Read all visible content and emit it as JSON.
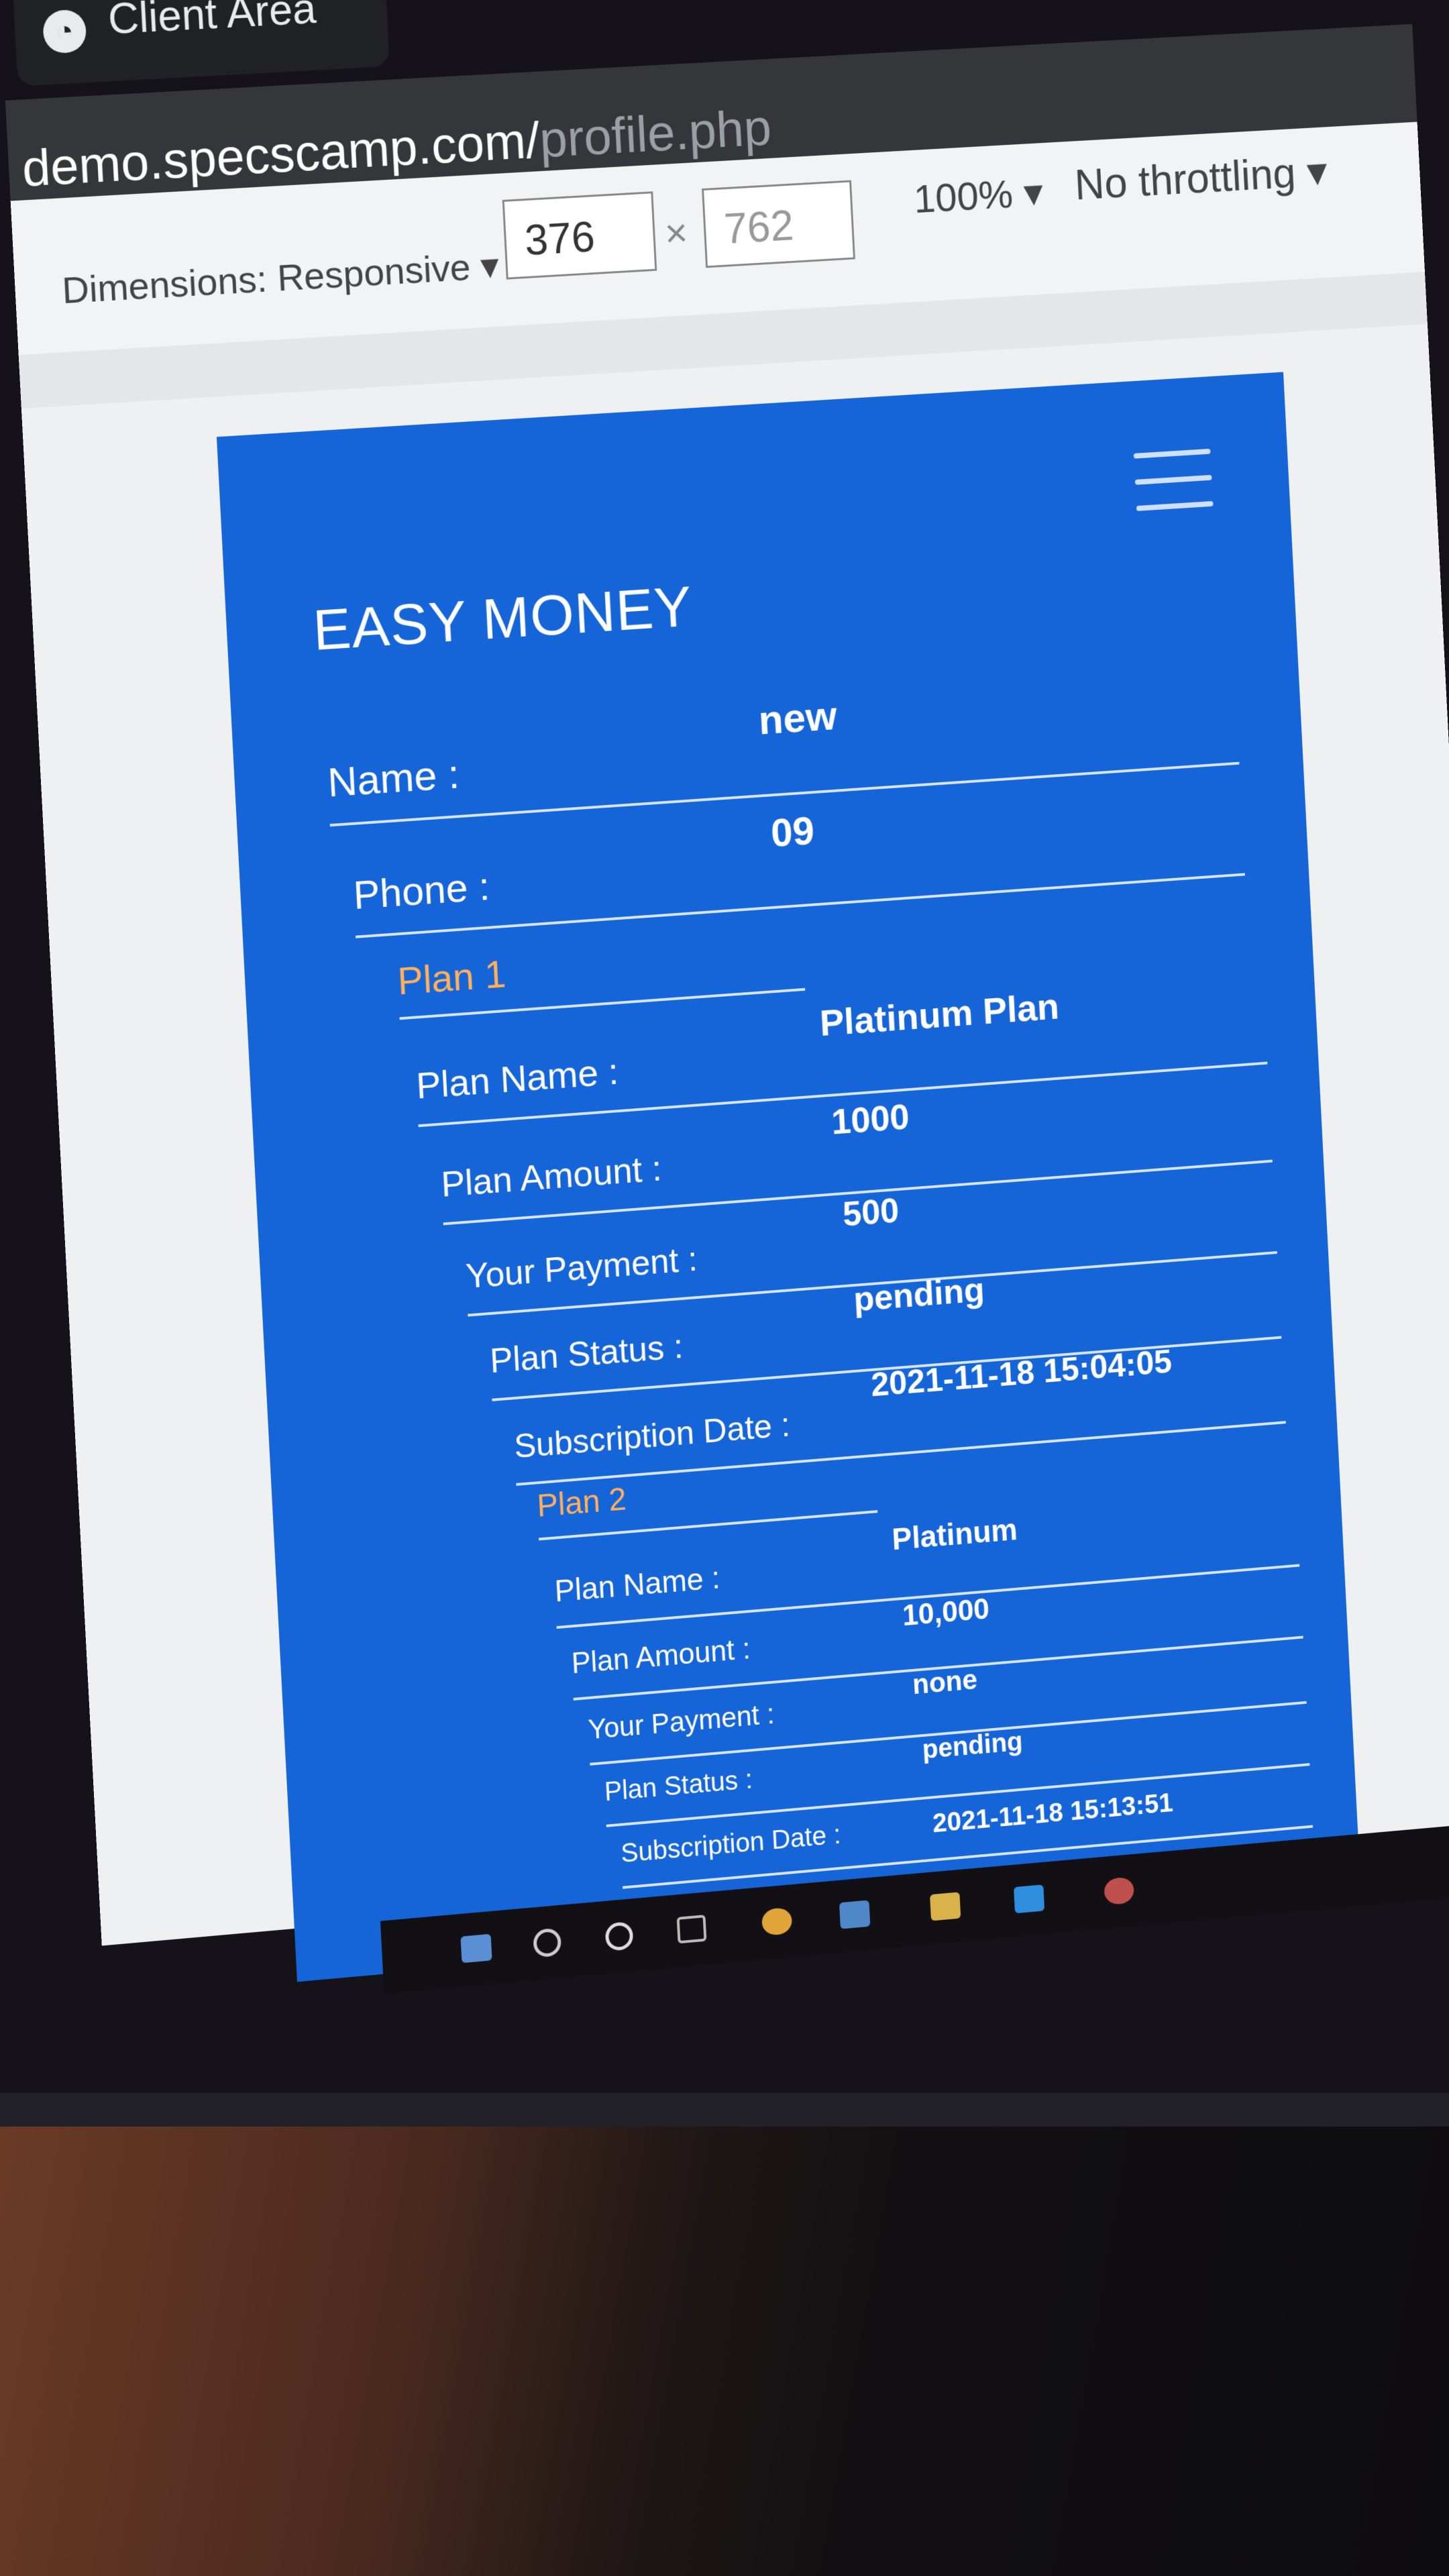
{
  "browser": {
    "tab_title": "Client Area",
    "url_host": "demo.specscamp.com/",
    "url_path": "profile.php"
  },
  "devtools": {
    "dimensions_label": "Dimensions: Responsive",
    "width": "376",
    "separator": "×",
    "height": "762",
    "zoom": "100%",
    "throttling": "No throttling"
  },
  "page": {
    "brand": "EASY MONEY",
    "name_label": "Name :",
    "name_value": "new",
    "phone_label": "Phone :",
    "phone_value": "09",
    "plans": [
      {
        "heading": "Plan 1",
        "plan_name_label": "Plan Name :",
        "plan_name": "Platinum Plan",
        "amount_label": "Plan Amount :",
        "amount": "1000",
        "payment_label": "Your Payment :",
        "payment": "500",
        "status_label": "Plan Status :",
        "status": "pending",
        "date_label": "Subscription Date :",
        "date": "2021-11-18 15:04:05"
      },
      {
        "heading": "Plan 2",
        "plan_name_label": "Plan Name :",
        "plan_name": "Platinum",
        "amount_label": "Plan Amount :",
        "amount": "10,000",
        "payment_label": "Your Payment :",
        "payment": "none",
        "status_label": "Plan Status :",
        "status": "pending",
        "date_label": "Subscription Date :",
        "date": "2021-11-18 15:13:51"
      }
    ]
  },
  "colors": {
    "page_bg": "#1565d8",
    "plan_heading": "#ffb05a",
    "text": "#ffffff"
  },
  "icons": {
    "menu": "hamburger-icon",
    "tab": "globe-icon",
    "taskbar": [
      "windows-icon",
      "search-icon",
      "cortana-icon",
      "task-view-icon",
      "chrome-icon",
      "app-icon",
      "file-explorer-icon",
      "vscode-icon",
      "chrome-dev-icon"
    ]
  }
}
